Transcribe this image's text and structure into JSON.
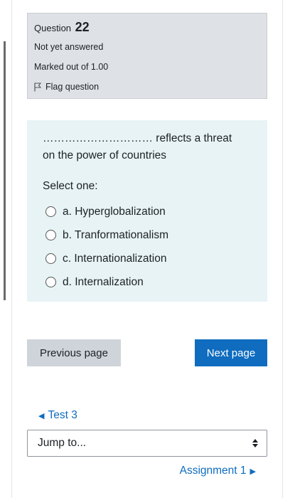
{
  "info": {
    "question_label": "Question",
    "question_number": "22",
    "state": "Not yet answered",
    "grade": "Marked out of 1.00",
    "flag_label": "Flag question"
  },
  "question": {
    "text_line1": "………………………… reflects a threat",
    "text_line2": "on the power of countries",
    "prompt": "Select one:",
    "options": [
      {
        "label": "a. Hyperglobalization"
      },
      {
        "label": "b. Tranformationalism"
      },
      {
        "label": "c. Internationalization"
      },
      {
        "label": "d. Internalization"
      }
    ]
  },
  "navigation": {
    "previous_page": "Previous page",
    "next_page": "Next page"
  },
  "activity_nav": {
    "previous_activity": "Test 3",
    "jump_to": "Jump to...",
    "next_activity": "Assignment 1"
  },
  "icons": {
    "flag": "flag-icon",
    "prev_arrow": "triangle-left-icon",
    "next_arrow": "triangle-right-icon",
    "select_arrows": "select-updown-icon"
  },
  "colors": {
    "info_bg": "#dee2e6",
    "formulation_bg": "#e7f3f5",
    "primary": "#0f6cbf",
    "secondary_btn": "#ced4da"
  }
}
